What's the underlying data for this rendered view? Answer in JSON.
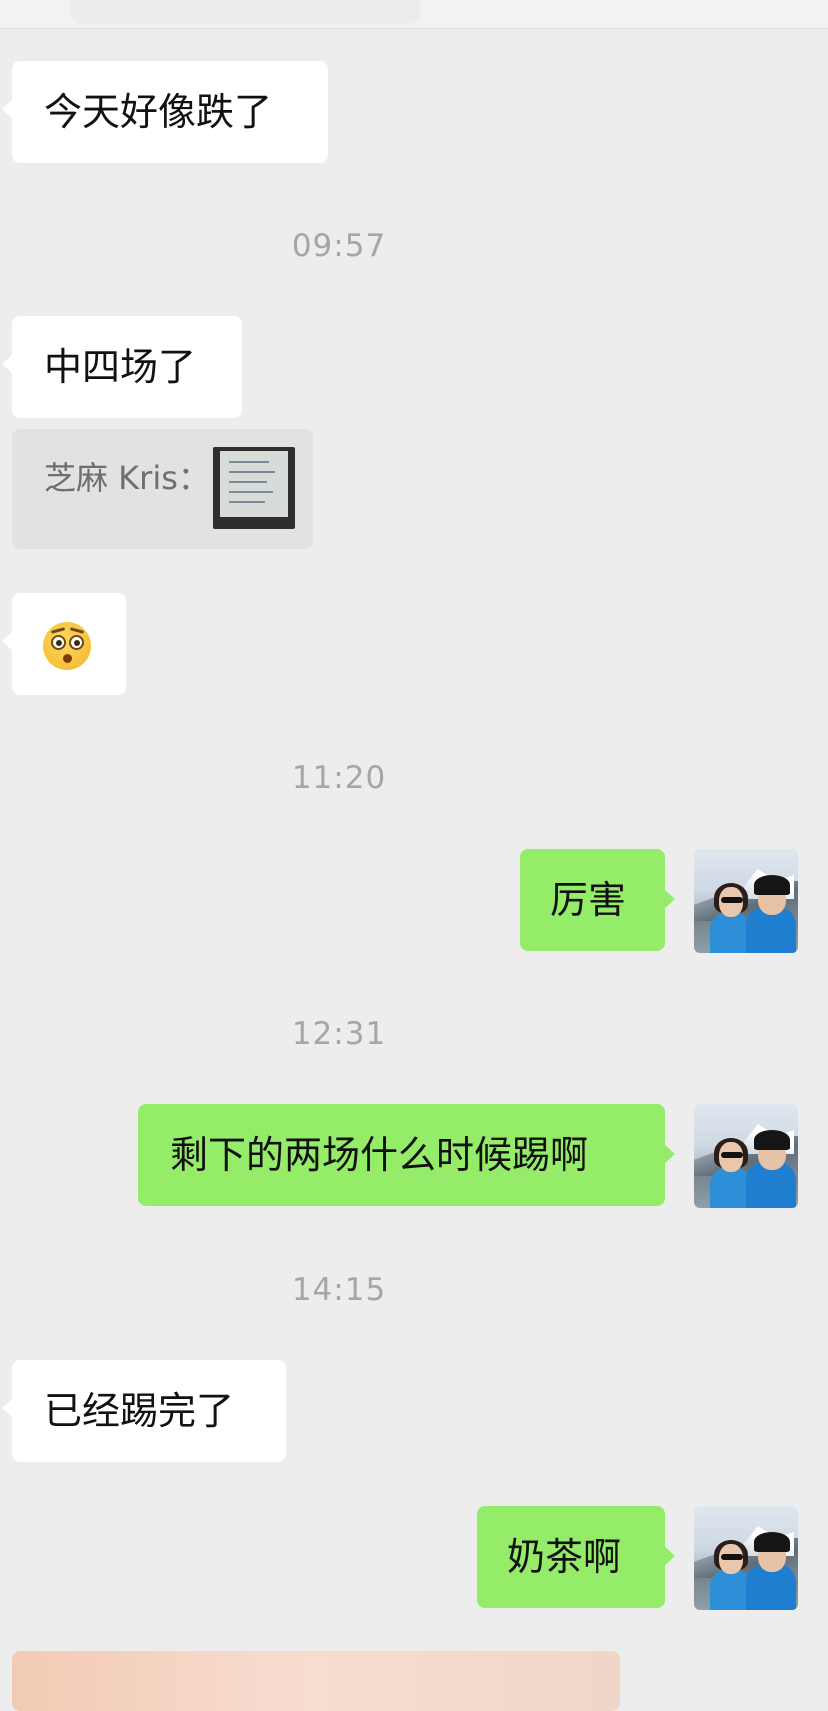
{
  "messages": [
    {
      "side": "left",
      "text": "今天好像跌了"
    },
    {
      "side": "time",
      "text": "09:57"
    },
    {
      "side": "left",
      "text": "中四场了"
    },
    {
      "side": "quote",
      "text": "芝麻 Kris："
    },
    {
      "side": "left",
      "emoji": "flushed-face"
    },
    {
      "side": "time",
      "text": "11:20"
    },
    {
      "side": "right",
      "text": "厉害"
    },
    {
      "side": "time",
      "text": "12:31"
    },
    {
      "side": "right",
      "text": "剩下的两场什么时候踢啊"
    },
    {
      "side": "time",
      "text": "14:15"
    },
    {
      "side": "left",
      "text": "已经踢完了"
    },
    {
      "side": "right",
      "text": "奶茶啊"
    }
  ],
  "icons": {
    "emoji": "flushed-face-icon",
    "avatar": "user-avatar"
  },
  "colors": {
    "background": "#ededed",
    "incoming_bubble": "#ffffff",
    "outgoing_bubble": "#95ec69",
    "timestamp": "#a6a6a6",
    "quote_background": "#e2e2e2"
  }
}
